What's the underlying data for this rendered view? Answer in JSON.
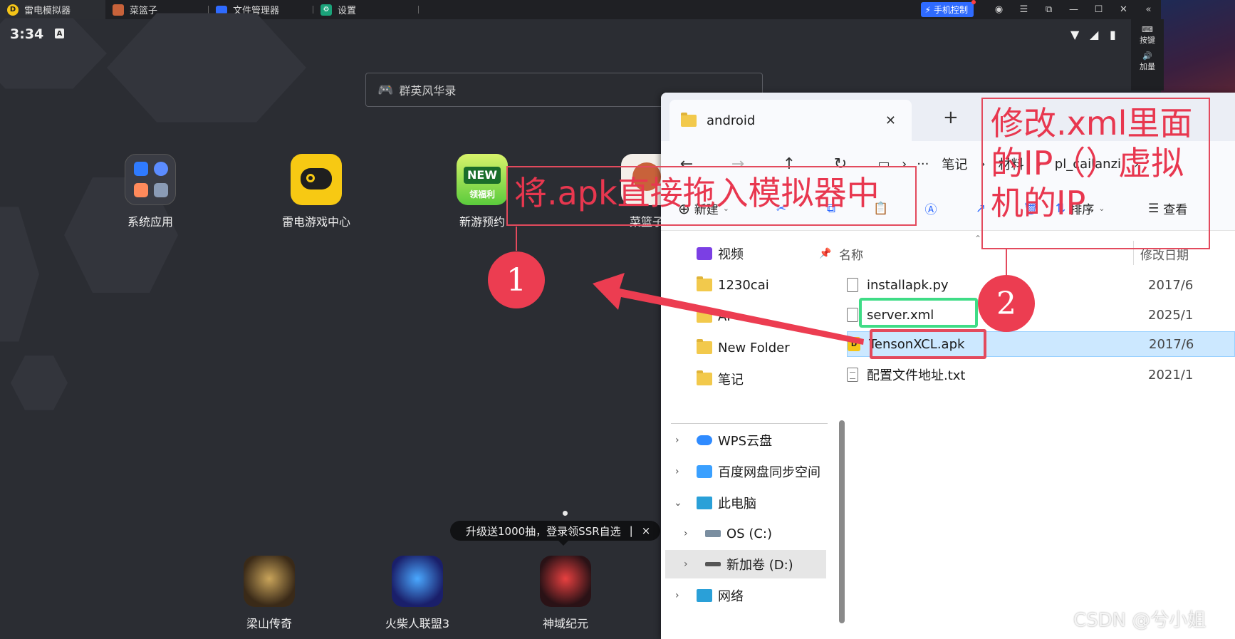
{
  "emulator": {
    "tabs": [
      {
        "label": "雷电模拟器",
        "icon": "leidian-logo-icon"
      },
      {
        "label": "菜篮子",
        "icon": "cailanzi-app-icon"
      },
      {
        "label": "文件管理器",
        "icon": "folder-icon"
      },
      {
        "label": "设置",
        "icon": "settings-icon"
      }
    ],
    "phone_control_label": "手机控制",
    "side_buttons": [
      "按键",
      "加量"
    ]
  },
  "android": {
    "time": "3:34",
    "badge": "A",
    "search_placeholder": "群英风华录",
    "apps": [
      {
        "label": "系统应用"
      },
      {
        "label": "雷电游戏中心"
      },
      {
        "label": "新游预约",
        "badge_top": "NEW",
        "badge_bottom": "领福利"
      },
      {
        "label": "菜篮子"
      }
    ],
    "promo_text": "升级送1000抽，登录领SSR自选",
    "promo_sep": "|",
    "promo_close": "×",
    "dock_apps": [
      {
        "label": "梁山传奇"
      },
      {
        "label": "火柴人联盟3"
      },
      {
        "label": "神域纪元"
      }
    ]
  },
  "explorer": {
    "tab_title": "android",
    "breadcrumbs": [
      "笔记",
      "材料",
      "pl_cailanzi"
    ],
    "more": "···",
    "toolbar": {
      "new_label": "新建",
      "sort_label": "排序",
      "view_label": "查看"
    },
    "nav": [
      {
        "label": "视频"
      },
      {
        "label": "1230cai"
      },
      {
        "label": "AI"
      },
      {
        "label": "New Folder"
      },
      {
        "label": "笔记"
      },
      {
        "label": "WPS云盘"
      },
      {
        "label": "百度网盘同步空间"
      },
      {
        "label": "此电脑"
      },
      {
        "label": "OS (C:)"
      },
      {
        "label": "新加卷 (D:)"
      },
      {
        "label": "网络"
      }
    ],
    "columns": {
      "name": "名称",
      "modified": "修改日期"
    },
    "files": [
      {
        "name": "installapk.py",
        "date": "2017/6"
      },
      {
        "name": "server.xml",
        "date": "2025/1"
      },
      {
        "name": "TensonXCL.apk",
        "date": "2017/6"
      },
      {
        "name": "配置文件地址.txt",
        "date": "2021/1"
      }
    ]
  },
  "annotations": {
    "step1_text": "将.apk直接拖入模拟器中",
    "step2_line1": "修改.xml里面",
    "step2_line2": "的IP（）虚拟",
    "step2_line3": "机的IP",
    "circle1": "1",
    "circle2": "2",
    "annotation_color": "#e8374f",
    "highlight_color": "#3fdc86"
  },
  "watermark": "CSDN @兮小姐"
}
